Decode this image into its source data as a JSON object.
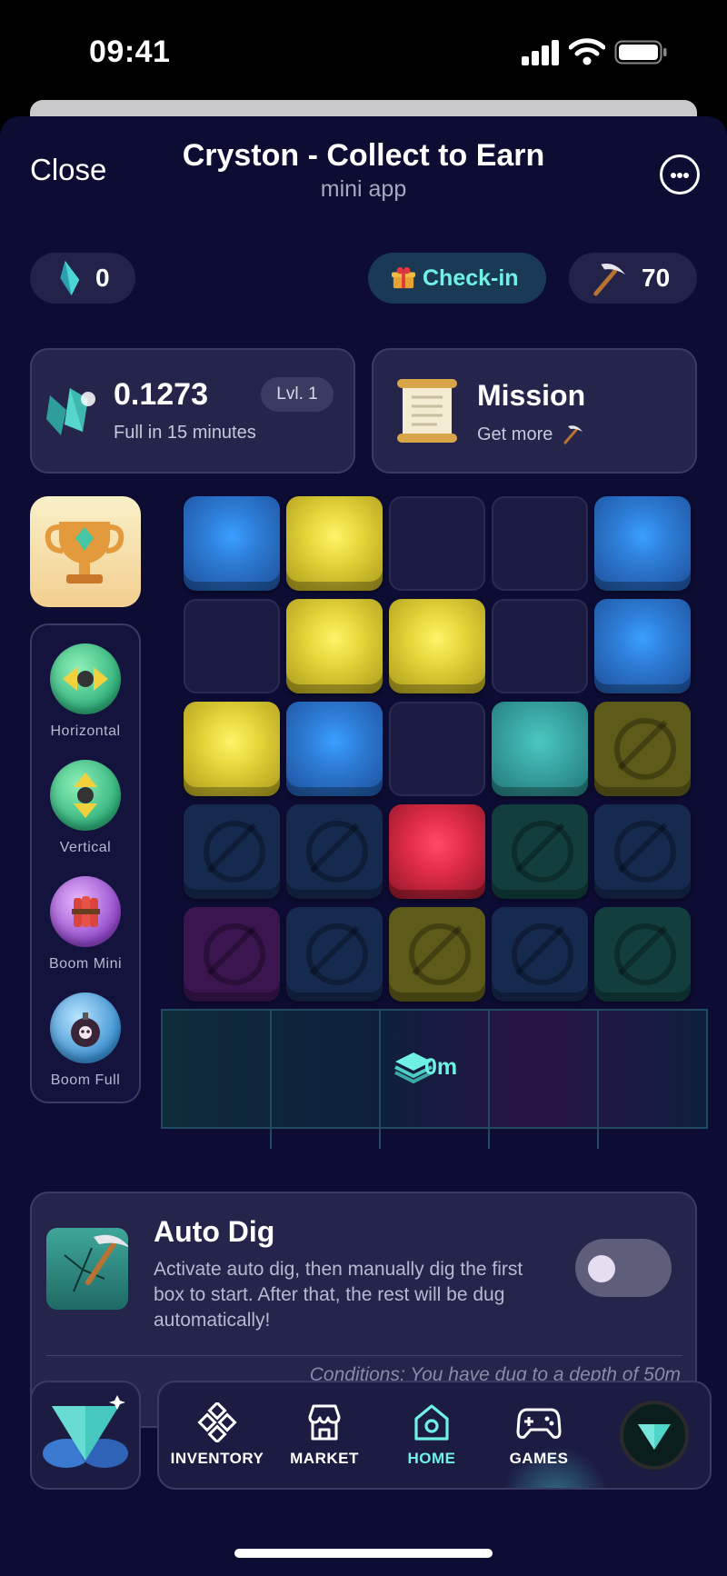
{
  "status_bar": {
    "time": "09:41"
  },
  "header": {
    "close_label": "Close",
    "title": "Cryston - Collect to Earn",
    "subtitle": "mini app",
    "more_icon": "more-horizontal-icon"
  },
  "topbar": {
    "gems": "0",
    "checkin_label": "Check-in",
    "pickaxes": "70"
  },
  "rate_card": {
    "value": "0.1273",
    "subtitle": "Full in 15 minutes",
    "level": "Lvl. 1"
  },
  "mission_card": {
    "title": "Mission",
    "subtitle": "Get more"
  },
  "tools": [
    {
      "label": "Horizontal"
    },
    {
      "label": "Vertical"
    },
    {
      "label": "Boom Mini"
    },
    {
      "label": "Boom Full"
    }
  ],
  "grid": {
    "rows": [
      [
        "blue",
        "yellow",
        "empty",
        "empty",
        "blue"
      ],
      [
        "empty",
        "yellow",
        "yellow",
        "empty",
        "blue"
      ],
      [
        "yellow",
        "blue",
        "empty",
        "teal",
        "locked-yellow"
      ],
      [
        "locked-blue",
        "locked-blue",
        "red",
        "locked-green",
        "locked-blue"
      ],
      [
        "locked-purple",
        "locked-blue",
        "locked-yellow",
        "locked-blue",
        "locked-green"
      ]
    ]
  },
  "depth": {
    "label": "0m"
  },
  "auto_dig": {
    "title": "Auto Dig",
    "description": "Activate auto dig, then manually dig the first box to start. After that, the rest will be dug automatically!",
    "enabled": false,
    "conditions": "Conditions: You have dug to a depth of 50m"
  },
  "nav": {
    "items": [
      {
        "label": "INVENTORY",
        "icon": "inventory-icon"
      },
      {
        "label": "MARKET",
        "icon": "market-icon"
      },
      {
        "label": "HOME",
        "icon": "home-icon",
        "active": true
      },
      {
        "label": "GAMES",
        "icon": "gamepad-icon"
      }
    ]
  },
  "colors": {
    "background": "#0d0c33",
    "accent": "#6ff1e4",
    "card": "#25254c"
  }
}
